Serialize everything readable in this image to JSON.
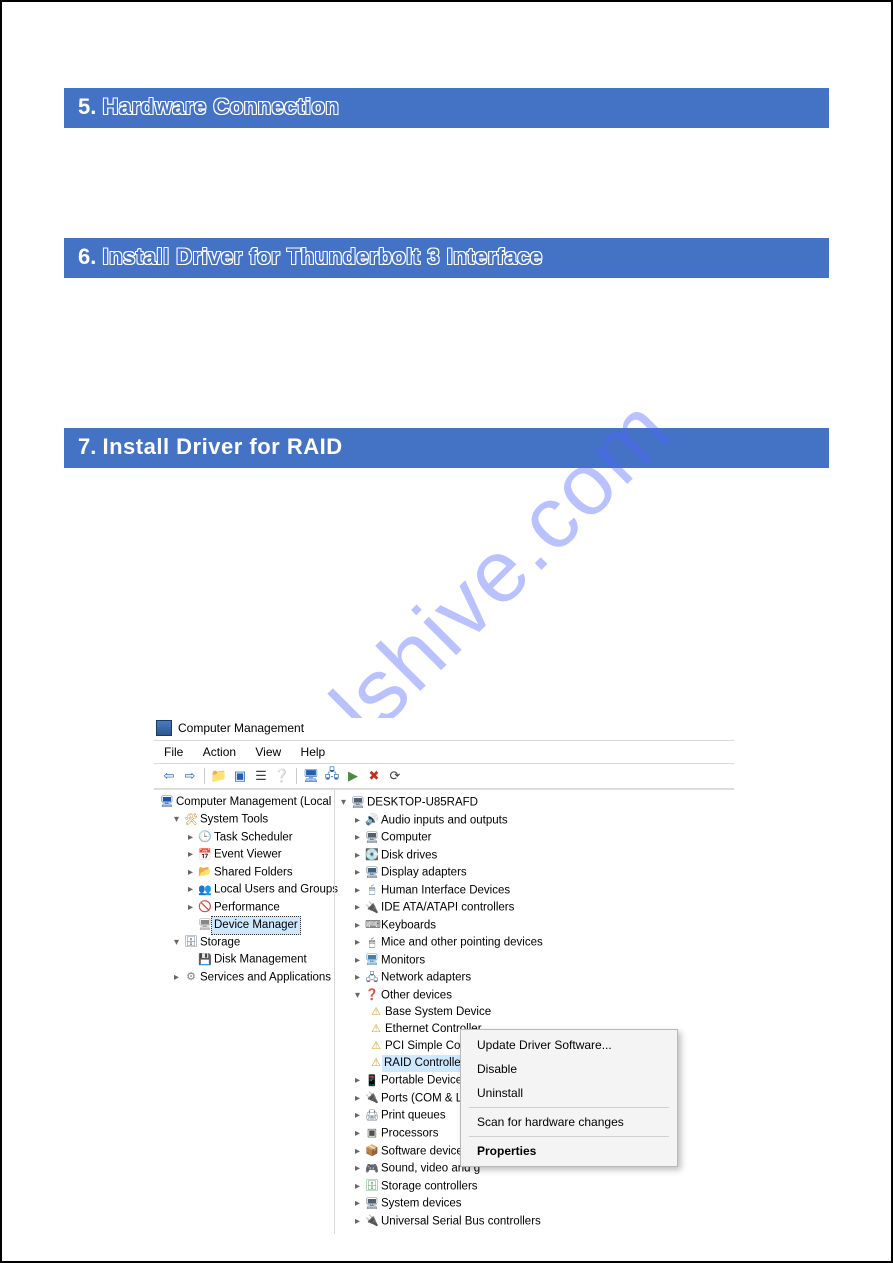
{
  "watermark": "nualshive.com",
  "sections": [
    {
      "num": "5.",
      "title": "Hardware Connection",
      "outline": true
    },
    {
      "num": "6.",
      "title": "Install Driver for Thunderbolt 3 Interface",
      "outline": true
    },
    {
      "num": "7.",
      "title": "Install Driver for RAID",
      "outline": false
    }
  ],
  "app": {
    "title": "Computer Management",
    "menus": [
      "File",
      "Action",
      "View",
      "Help"
    ],
    "root_device": "DESKTOP-U85RAFD",
    "left_tree": {
      "root": "Computer Management (Local",
      "system_tools": "System Tools",
      "task_scheduler": "Task Scheduler",
      "event_viewer": "Event Viewer",
      "shared_folders": "Shared Folders",
      "local_users": "Local Users and Groups",
      "performance": "Performance",
      "device_manager": "Device Manager",
      "storage": "Storage",
      "disk_management": "Disk Management",
      "services_apps": "Services and Applications"
    },
    "devices": {
      "audio": "Audio inputs and outputs",
      "computer": "Computer",
      "disk_drives": "Disk drives",
      "display": "Display adapters",
      "hid": "Human Interface Devices",
      "ide": "IDE ATA/ATAPI controllers",
      "keyboards": "Keyboards",
      "mice": "Mice and other pointing devices",
      "monitors": "Monitors",
      "network": "Network adapters",
      "other": "Other devices",
      "base_system": "Base System Device",
      "ethernet": "Ethernet Controller",
      "pci_simple": "PCI Simple Communications Controller",
      "raid": "RAID Controller",
      "portable": "Portable Devices",
      "ports": "Ports (COM & LPT)",
      "print_queues": "Print queues",
      "processors": "Processors",
      "software": "Software devices",
      "sound": "Sound, video and g",
      "storage_ctrl": "Storage controllers",
      "system_dev": "System devices",
      "usb": "Universal Serial Bus controllers"
    },
    "context_menu": {
      "update": "Update Driver Software...",
      "disable": "Disable",
      "uninstall": "Uninstall",
      "scan": "Scan for hardware changes",
      "properties": "Properties"
    }
  }
}
